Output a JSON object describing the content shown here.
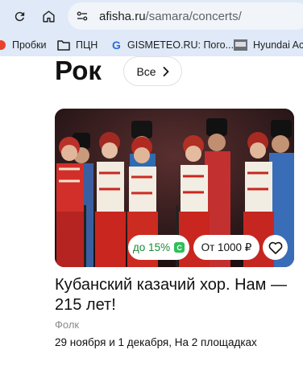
{
  "browser": {
    "url_domain": "afisha.ru",
    "url_path": "/samara/concerts/",
    "bookmarks": [
      {
        "label": "Пробки"
      },
      {
        "label": "ПЦН"
      },
      {
        "label": "GISMETEO.RU: Пого..."
      },
      {
        "label": "Hyundai Acc"
      }
    ]
  },
  "section": {
    "title": "Рок",
    "all_label": "Все"
  },
  "event": {
    "discount_label": "до 15%",
    "price_label": "От 1000 ₽",
    "title": "Кубанский казачий хор. Нам — 215 лет!",
    "genre": "Фолк",
    "dates": "29 ноября и 1 декабря, На 2 площадках"
  }
}
